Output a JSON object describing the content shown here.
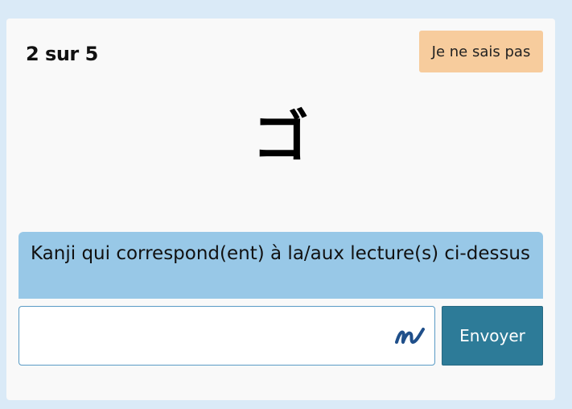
{
  "quiz": {
    "progress": "2 sur 5",
    "dont_know_label": "Je ne sais pas",
    "character": "ゴ",
    "prompt": "Kanji qui correspond(ent) à la/aux lecture(s) ci-dessus",
    "answer_value": "",
    "submit_label": "Envoyer"
  },
  "icons": {
    "handwriting": "handwriting-icon"
  },
  "colors": {
    "background": "#daeaf7",
    "card": "#f9f9f9",
    "dont_know_button": "#f7cc9d",
    "prompt_bar": "#98c8e7",
    "submit_button": "#2d7b98",
    "input_border": "#5a9bc5",
    "handwriting_icon": "#1f4f8a"
  }
}
